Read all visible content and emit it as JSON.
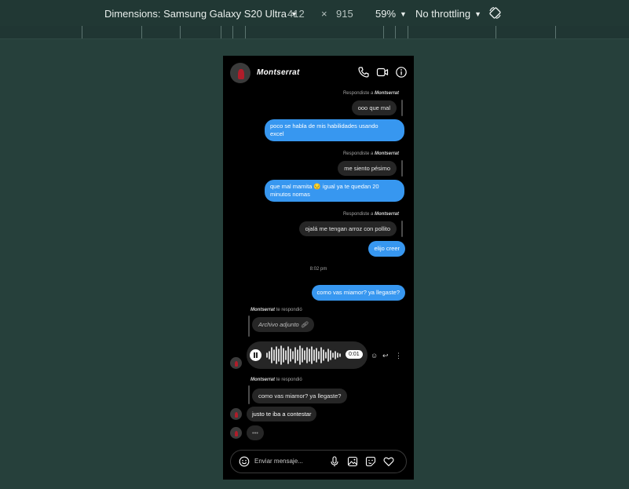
{
  "devtools": {
    "device_label": "Dimensions: Samsung Galaxy S20 Ultra",
    "width": "412",
    "times": "×",
    "height": "915",
    "zoom": "59%",
    "throttling": "No throttling"
  },
  "chat": {
    "contact_name": "Montserrat",
    "reply_prefix": "Respondiste a",
    "them_reply_suffix": "te respondió",
    "messages": {
      "q1": "ooo que mal",
      "m1_l1": "poco se habla de mis habilidades usando",
      "m1_l2": "excel",
      "q2": "me siento pésimo",
      "m2_l1": "que mal mamita 😔 igual ya te quedan 20",
      "m2_l2": "minutos nomas",
      "q3": "ojalá me tengan arroz con pollito",
      "m3": "elijo creer",
      "time": "8:02 pm",
      "m4": "como vas miamor? ya llegaste?",
      "attachment": "Archivo adjunto",
      "voice_duration": "0:01",
      "q4": "como vas miamor? ya llegaste?",
      "t1": "justo te iba a contestar",
      "typing": "•••"
    },
    "composer": {
      "placeholder": "Enviar mensaje..."
    }
  }
}
